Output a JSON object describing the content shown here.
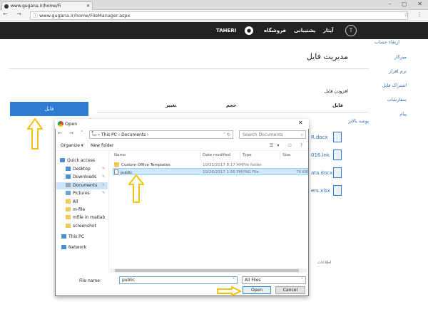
{
  "browser": {
    "tab_title": "www.gugana.ir/home/Fi",
    "url": "www.gugana.ir/home/FileManager.aspx"
  },
  "nav": {
    "brand": "آپتار",
    "support": "پشتیبانی",
    "store": "فروشگاه",
    "user": "TAHERI",
    "upgrade": "ارتقاء حساب"
  },
  "page": {
    "title": "مدیریت فایل",
    "add_file": "افزودن فایل",
    "file_button": "فایل",
    "folder_up": "پوشه بالاتر",
    "notes": "اطلاعات"
  },
  "sidebar": {
    "items": [
      "میزکار",
      "نرم افزار",
      "اشتراک فایل",
      "سفارشات",
      "پیام"
    ]
  },
  "table": {
    "headers": [
      "فایل",
      "حجم",
      "تغییر"
    ],
    "rows": [
      "R.docx",
      "016.lnk",
      "ata.docx",
      "ers.xlsx"
    ]
  },
  "dialog": {
    "title": "Open",
    "path": [
      "This PC",
      "Documents"
    ],
    "search_placeholder": "Search Documents",
    "organize": "Organize ▾",
    "new_folder": "New folder",
    "tree": [
      "Quick access",
      "Desktop",
      "Downloads",
      "Documents",
      "Pictures",
      "All",
      "m-file",
      "mfile in matlab",
      "screenshot",
      "This PC",
      "Network"
    ],
    "columns": [
      "Name",
      "Date modified",
      "Type",
      "Size"
    ],
    "files": [
      {
        "name": "Custom Office Templates",
        "date": "10/31/2017 8:17 AM",
        "type": "File folder",
        "size": ""
      },
      {
        "name": "public",
        "date": "10/26/2017 1:56 PM",
        "type": "PNG File",
        "size": "76 KB"
      }
    ],
    "filename_label": "File name:",
    "filename_value": "public",
    "filter": "All Files",
    "open": "Open",
    "cancel": "Cancel"
  },
  "colors": {
    "nav_bg": "#222222",
    "accent": "#2e7bd2",
    "arrow": "#f4c20d"
  }
}
